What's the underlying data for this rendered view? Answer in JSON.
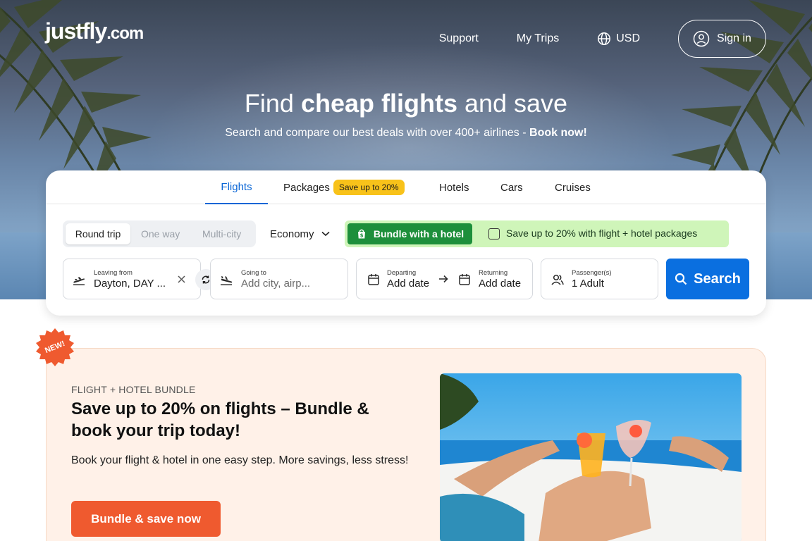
{
  "brand": {
    "logo_main": "justfly",
    "logo_suffix": ".com"
  },
  "nav": {
    "support": "Support",
    "my_trips": "My Trips",
    "currency": "USD",
    "sign_in": "Sign in"
  },
  "hero": {
    "headline_pre": "Find ",
    "headline_bold": "cheap flights",
    "headline_post": " and save",
    "sub_text": "Search and compare our best deals with over 400+ airlines - ",
    "sub_bold": "Book now!"
  },
  "tabs": [
    {
      "label": "Flights",
      "active": true
    },
    {
      "label": "Packages",
      "badge": "Save up to 20%"
    },
    {
      "label": "Hotels"
    },
    {
      "label": "Cars"
    },
    {
      "label": "Cruises"
    }
  ],
  "trip_types": [
    "Round trip",
    "One way",
    "Multi-city"
  ],
  "cabin": {
    "value": "Economy"
  },
  "bundle": {
    "button": "Bundle with a hotel",
    "checkbox_label": "Save up to 20% with flight + hotel packages",
    "checked": false
  },
  "fields": {
    "from_label": "Leaving from",
    "from_value": "Dayton, DAY ...",
    "to_label": "Going to",
    "to_placeholder": "Add city, airp...",
    "depart_label": "Departing",
    "depart_value": "Add date",
    "return_label": "Returning",
    "return_value": "Add date",
    "pax_label": "Passenger(s)",
    "pax_value": "1 Adult"
  },
  "search_button": "Search",
  "promo": {
    "badge": "NEW!",
    "eyebrow": "FLIGHT + HOTEL BUNDLE",
    "title": "Save up to 20% on flights – Bundle & book your trip today!",
    "description": "Book your flight & hotel in one easy step. More savings, less stress!",
    "cta": "Bundle & save now"
  },
  "colors": {
    "primary_blue": "#0a6fe0",
    "bundle_green": "#1d8f3b",
    "bundle_bg": "#cff5b9",
    "promo_orange": "#ef5a2f",
    "badge_yellow": "#f8c21a"
  }
}
